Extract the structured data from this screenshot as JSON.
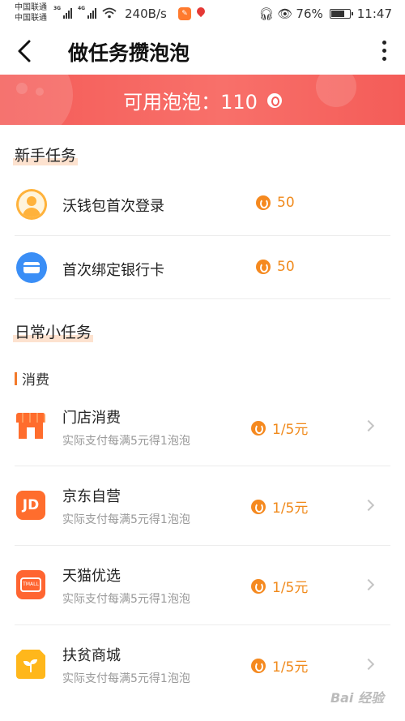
{
  "status_bar": {
    "carrier_1": "中国联通",
    "carrier_2": "中国联通",
    "net_1": "3G",
    "net_2": "4G",
    "speed": "240B/s",
    "battery": "76%",
    "battery_level": 0.76,
    "time": "11:47"
  },
  "header": {
    "title": "做任务攒泡泡"
  },
  "banner": {
    "text": "可用泡泡：110"
  },
  "sections": {
    "newbie_title": "新手任务",
    "daily_title": "日常小任务",
    "consume_title": "消费"
  },
  "newbie_tasks": [
    {
      "label": "沃钱包首次登录",
      "reward": "50",
      "icon": "user-avatar-icon"
    },
    {
      "label": "首次绑定银行卡",
      "reward": "50",
      "icon": "bank-card-icon"
    }
  ],
  "consume_tasks": [
    {
      "label": "门店消费",
      "desc": "实际支付每满5元得1泡泡",
      "reward": "1/5元",
      "icon": "store-icon"
    },
    {
      "label": "京东自营",
      "desc": "实际支付每满5元得1泡泡",
      "reward": "1/5元",
      "icon": "jd-icon",
      "icon_text": "JD"
    },
    {
      "label": "天猫优选",
      "desc": "实际支付每满5元得1泡泡",
      "reward": "1/5元",
      "icon": "tmall-icon",
      "icon_text": "TMALL"
    },
    {
      "label": "扶贫商城",
      "desc": "实际支付每满5元得1泡泡",
      "reward": "1/5元",
      "icon": "poverty-mall-icon"
    }
  ],
  "watermark": "Bai 经验",
  "colors": {
    "banner": "#f45c58",
    "accent": "#f08a1c",
    "highlight": "#fde2cf"
  }
}
